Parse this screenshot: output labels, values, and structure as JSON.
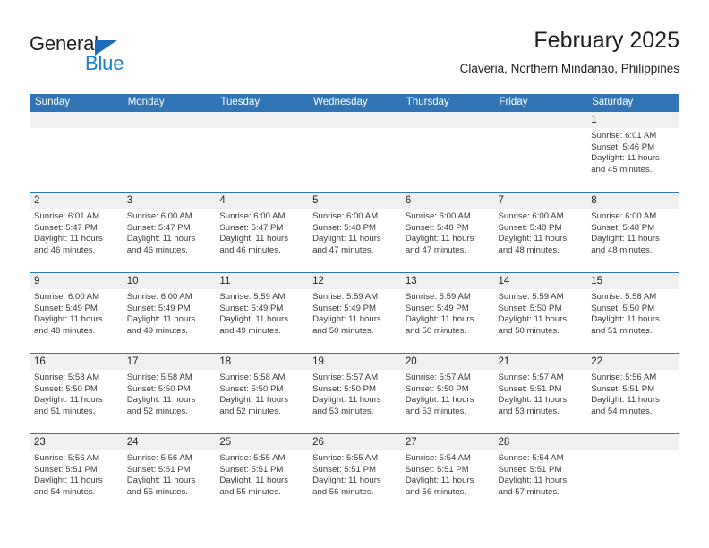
{
  "brand": {
    "name_part1": "General",
    "name_part2": "Blue",
    "triangle_color": "#1d6cb5",
    "blue_color": "#1d7fd0"
  },
  "header": {
    "title": "February 2025",
    "subtitle": "Claveria, Northern Mindanao, Philippines",
    "accent_color": "#3175b7"
  },
  "calendar": {
    "weekday_headers": [
      "Sunday",
      "Monday",
      "Tuesday",
      "Wednesday",
      "Thursday",
      "Friday",
      "Saturday"
    ],
    "weeks": [
      [
        {
          "day": "",
          "sunrise": "",
          "sunset": "",
          "daylight": "",
          "empty": true
        },
        {
          "day": "",
          "sunrise": "",
          "sunset": "",
          "daylight": "",
          "empty": true
        },
        {
          "day": "",
          "sunrise": "",
          "sunset": "",
          "daylight": "",
          "empty": true
        },
        {
          "day": "",
          "sunrise": "",
          "sunset": "",
          "daylight": "",
          "empty": true
        },
        {
          "day": "",
          "sunrise": "",
          "sunset": "",
          "daylight": "",
          "empty": true
        },
        {
          "day": "",
          "sunrise": "",
          "sunset": "",
          "daylight": "",
          "empty": true
        },
        {
          "day": "1",
          "sunrise": "Sunrise: 6:01 AM",
          "sunset": "Sunset: 5:46 PM",
          "daylight": "Daylight: 11 hours and 45 minutes.",
          "empty": false
        }
      ],
      [
        {
          "day": "2",
          "sunrise": "Sunrise: 6:01 AM",
          "sunset": "Sunset: 5:47 PM",
          "daylight": "Daylight: 11 hours and 46 minutes.",
          "empty": false
        },
        {
          "day": "3",
          "sunrise": "Sunrise: 6:00 AM",
          "sunset": "Sunset: 5:47 PM",
          "daylight": "Daylight: 11 hours and 46 minutes.",
          "empty": false
        },
        {
          "day": "4",
          "sunrise": "Sunrise: 6:00 AM",
          "sunset": "Sunset: 5:47 PM",
          "daylight": "Daylight: 11 hours and 46 minutes.",
          "empty": false
        },
        {
          "day": "5",
          "sunrise": "Sunrise: 6:00 AM",
          "sunset": "Sunset: 5:48 PM",
          "daylight": "Daylight: 11 hours and 47 minutes.",
          "empty": false
        },
        {
          "day": "6",
          "sunrise": "Sunrise: 6:00 AM",
          "sunset": "Sunset: 5:48 PM",
          "daylight": "Daylight: 11 hours and 47 minutes.",
          "empty": false
        },
        {
          "day": "7",
          "sunrise": "Sunrise: 6:00 AM",
          "sunset": "Sunset: 5:48 PM",
          "daylight": "Daylight: 11 hours and 48 minutes.",
          "empty": false
        },
        {
          "day": "8",
          "sunrise": "Sunrise: 6:00 AM",
          "sunset": "Sunset: 5:48 PM",
          "daylight": "Daylight: 11 hours and 48 minutes.",
          "empty": false
        }
      ],
      [
        {
          "day": "9",
          "sunrise": "Sunrise: 6:00 AM",
          "sunset": "Sunset: 5:49 PM",
          "daylight": "Daylight: 11 hours and 48 minutes.",
          "empty": false
        },
        {
          "day": "10",
          "sunrise": "Sunrise: 6:00 AM",
          "sunset": "Sunset: 5:49 PM",
          "daylight": "Daylight: 11 hours and 49 minutes.",
          "empty": false
        },
        {
          "day": "11",
          "sunrise": "Sunrise: 5:59 AM",
          "sunset": "Sunset: 5:49 PM",
          "daylight": "Daylight: 11 hours and 49 minutes.",
          "empty": false
        },
        {
          "day": "12",
          "sunrise": "Sunrise: 5:59 AM",
          "sunset": "Sunset: 5:49 PM",
          "daylight": "Daylight: 11 hours and 50 minutes.",
          "empty": false
        },
        {
          "day": "13",
          "sunrise": "Sunrise: 5:59 AM",
          "sunset": "Sunset: 5:49 PM",
          "daylight": "Daylight: 11 hours and 50 minutes.",
          "empty": false
        },
        {
          "day": "14",
          "sunrise": "Sunrise: 5:59 AM",
          "sunset": "Sunset: 5:50 PM",
          "daylight": "Daylight: 11 hours and 50 minutes.",
          "empty": false
        },
        {
          "day": "15",
          "sunrise": "Sunrise: 5:58 AM",
          "sunset": "Sunset: 5:50 PM",
          "daylight": "Daylight: 11 hours and 51 minutes.",
          "empty": false
        }
      ],
      [
        {
          "day": "16",
          "sunrise": "Sunrise: 5:58 AM",
          "sunset": "Sunset: 5:50 PM",
          "daylight": "Daylight: 11 hours and 51 minutes.",
          "empty": false
        },
        {
          "day": "17",
          "sunrise": "Sunrise: 5:58 AM",
          "sunset": "Sunset: 5:50 PM",
          "daylight": "Daylight: 11 hours and 52 minutes.",
          "empty": false
        },
        {
          "day": "18",
          "sunrise": "Sunrise: 5:58 AM",
          "sunset": "Sunset: 5:50 PM",
          "daylight": "Daylight: 11 hours and 52 minutes.",
          "empty": false
        },
        {
          "day": "19",
          "sunrise": "Sunrise: 5:57 AM",
          "sunset": "Sunset: 5:50 PM",
          "daylight": "Daylight: 11 hours and 53 minutes.",
          "empty": false
        },
        {
          "day": "20",
          "sunrise": "Sunrise: 5:57 AM",
          "sunset": "Sunset: 5:50 PM",
          "daylight": "Daylight: 11 hours and 53 minutes.",
          "empty": false
        },
        {
          "day": "21",
          "sunrise": "Sunrise: 5:57 AM",
          "sunset": "Sunset: 5:51 PM",
          "daylight": "Daylight: 11 hours and 53 minutes.",
          "empty": false
        },
        {
          "day": "22",
          "sunrise": "Sunrise: 5:56 AM",
          "sunset": "Sunset: 5:51 PM",
          "daylight": "Daylight: 11 hours and 54 minutes.",
          "empty": false
        }
      ],
      [
        {
          "day": "23",
          "sunrise": "Sunrise: 5:56 AM",
          "sunset": "Sunset: 5:51 PM",
          "daylight": "Daylight: 11 hours and 54 minutes.",
          "empty": false
        },
        {
          "day": "24",
          "sunrise": "Sunrise: 5:56 AM",
          "sunset": "Sunset: 5:51 PM",
          "daylight": "Daylight: 11 hours and 55 minutes.",
          "empty": false
        },
        {
          "day": "25",
          "sunrise": "Sunrise: 5:55 AM",
          "sunset": "Sunset: 5:51 PM",
          "daylight": "Daylight: 11 hours and 55 minutes.",
          "empty": false
        },
        {
          "day": "26",
          "sunrise": "Sunrise: 5:55 AM",
          "sunset": "Sunset: 5:51 PM",
          "daylight": "Daylight: 11 hours and 56 minutes.",
          "empty": false
        },
        {
          "day": "27",
          "sunrise": "Sunrise: 5:54 AM",
          "sunset": "Sunset: 5:51 PM",
          "daylight": "Daylight: 11 hours and 56 minutes.",
          "empty": false
        },
        {
          "day": "28",
          "sunrise": "Sunrise: 5:54 AM",
          "sunset": "Sunset: 5:51 PM",
          "daylight": "Daylight: 11 hours and 57 minutes.",
          "empty": false
        },
        {
          "day": "",
          "sunrise": "",
          "sunset": "",
          "daylight": "",
          "empty": true
        }
      ]
    ]
  }
}
